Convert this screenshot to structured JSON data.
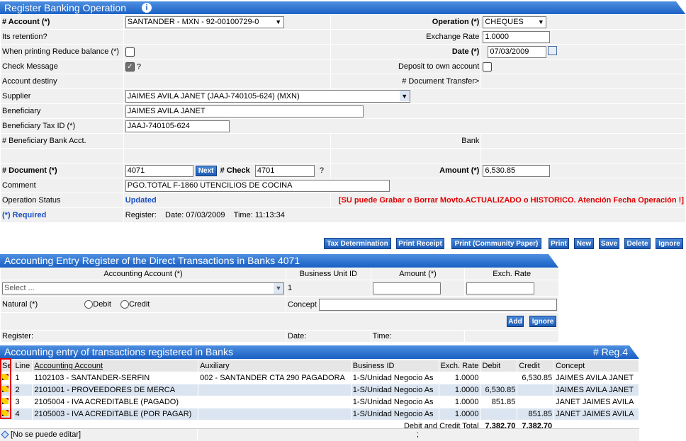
{
  "header1": {
    "title": "Register Banking Operation",
    "info_icon": "info-icon"
  },
  "form": {
    "account_label": "# Account (*)",
    "account_value": "SANTANDER - MXN - 92-00100729-0",
    "operation_label": "Operation (*)",
    "operation_value": "CHEQUES",
    "retention_label": "Its retention?",
    "exchange_label": "Exchange Rate",
    "exchange_value": "1.0000",
    "reduce_label": "When printing Reduce balance (*)",
    "date_label": "Date (*)",
    "date_value": "07/03/2009",
    "check_message_label": "Check Message",
    "check_message_q": "?",
    "deposit_label": "Deposit to own account",
    "account_destiny_label": "Account destiny",
    "doc_transfer_label": "# Document Transfer>",
    "supplier_label": "Supplier",
    "supplier_value": "JAIMES AVILA JANET (JAAJ-740105-624) (MXN)",
    "beneficiary_label": "Beneficiary",
    "beneficiary_value": "JAIMES AVILA JANET",
    "tax_label": "Beneficiary Tax ID (*)",
    "tax_value": "JAAJ-740105-624",
    "bank_acct_label": "# Beneficiary Bank Acct.",
    "bank_label": "Bank",
    "document_label": "# Document (*)",
    "document_value": "4071",
    "next_label": "Next",
    "check_label": "# Check",
    "check_value": "4701",
    "check_q": "?",
    "amount_label": "Amount (*)",
    "amount_value": "6,530.85",
    "comment_label": "Comment",
    "comment_value": "PGO.TOTAL F-1860 UTENCILIOS DE COCINA",
    "status_label": "Operation Status",
    "status_value": "Updated",
    "status_warning": "[SU puede Grabar o Borrar Movto.ACTUALIZADO o HISTORICO. Atención Fecha Operación !]",
    "required_label": "(*) Required",
    "register_label": "Register:",
    "reg_date": "Date: 07/03/2009",
    "reg_time": "Time: 11:13:34"
  },
  "buttons": [
    "Tax Determination",
    "Print Receipt",
    "Print (Community Paper)",
    "Print",
    "New",
    "Save",
    "Delete",
    "Ignore"
  ],
  "header2": {
    "title": "Accounting Entry Register of the Direct Transactions in Banks 4071"
  },
  "entry": {
    "acc_account_label": "Accounting Account (*)",
    "bu_label": "Business Unit ID",
    "amount_label": "Amount (*)",
    "exch_label": "Exch. Rate",
    "select_placeholder": "Select ...",
    "bu_value": "1",
    "natural_label": "Natural (*)",
    "debit_label": "Debit",
    "credit_label": "Credit",
    "concept_label": "Concept",
    "add_label": "Add",
    "ignore_label": "Ignore",
    "register_label": "Register:",
    "date_label": "Date:",
    "time_label": "Time:"
  },
  "header3": {
    "title": "Accounting entry of transactions registered in Banks",
    "reg": "# Reg.4"
  },
  "table": {
    "columns": [
      "Se",
      "Line",
      "Accounting Account",
      "Auxiliary",
      "Business ID",
      "Exch. Rate",
      "Debit",
      "Credit",
      "Concept"
    ],
    "rows": [
      [
        "1",
        "1102103 - SANTANDER-SERFIN",
        "002 - SANTANDER CTA 290 PAGADORA",
        "1-S/Unidad Negocio As",
        "1.0000",
        "",
        "6,530.85",
        "JAIMES AVILA JANET"
      ],
      [
        "2",
        "2101001 - PROVEEDORES DE MERCA",
        "",
        "1-S/Unidad Negocio As",
        "1.0000",
        "6,530.85",
        "",
        "JAIMES AVILA JANET"
      ],
      [
        "3",
        "2105004 - IVA ACREDITABLE (PAGADO)",
        "",
        "1-S/Unidad Negocio As",
        "1.0000",
        "851.85",
        "",
        "JANET JAIMES AVILA"
      ],
      [
        "4",
        "2105003 - IVA ACREDITABLE (POR PAGAR)",
        "",
        "1-S/Unidad Negocio As",
        "1.0000",
        "",
        "851.85",
        "JANET JAIMES AVILA"
      ]
    ],
    "total_label": "Debit and Credit Total",
    "total_debit": "7,382.70",
    "total_credit": "7,382.70",
    "footer_note": "[No se puede editar]",
    "footer_semicolon": ";"
  }
}
